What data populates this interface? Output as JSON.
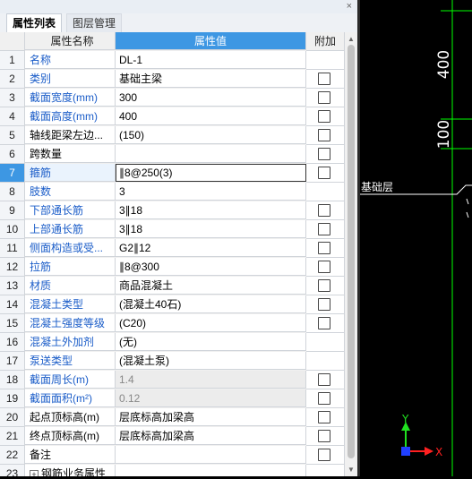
{
  "panel": {
    "close_glyph": "×",
    "tabs": [
      {
        "label": "属性列表"
      },
      {
        "label": "图层管理"
      }
    ],
    "headers": {
      "name": "属性名称",
      "value": "属性值",
      "add": "附加"
    }
  },
  "rows": [
    {
      "num": "1",
      "name": "名称",
      "value": "DL-1",
      "name_style": "blue",
      "checkbox": false
    },
    {
      "num": "2",
      "name": "类别",
      "value": "基础主梁",
      "name_style": "blue",
      "checkbox": true
    },
    {
      "num": "3",
      "name": "截面宽度(mm)",
      "value": "300",
      "name_style": "blue",
      "checkbox": true
    },
    {
      "num": "4",
      "name": "截面高度(mm)",
      "value": "400",
      "name_style": "blue",
      "checkbox": true
    },
    {
      "num": "5",
      "name": "轴线距梁左边...",
      "value": "(150)",
      "name_style": "black",
      "checkbox": true
    },
    {
      "num": "6",
      "name": "跨数量",
      "value": "",
      "name_style": "black",
      "checkbox": true
    },
    {
      "num": "7",
      "name": "箍筋",
      "value": "∥8@250(3)",
      "name_style": "blue",
      "checkbox": true,
      "selected": true
    },
    {
      "num": "8",
      "name": "肢数",
      "value": "3",
      "name_style": "blue",
      "checkbox": false
    },
    {
      "num": "9",
      "name": "下部通长筋",
      "value": "3∥18",
      "name_style": "blue",
      "checkbox": true
    },
    {
      "num": "10",
      "name": "上部通长筋",
      "value": "3∥18",
      "name_style": "blue",
      "checkbox": true
    },
    {
      "num": "11",
      "name": "侧面构造或受...",
      "value": "G2∥12",
      "name_style": "blue",
      "checkbox": true
    },
    {
      "num": "12",
      "name": "拉筋",
      "value": "∥8@300",
      "name_style": "blue",
      "checkbox": true
    },
    {
      "num": "13",
      "name": "材质",
      "value": "商品混凝土",
      "name_style": "blue",
      "checkbox": true
    },
    {
      "num": "14",
      "name": "混凝土类型",
      "value": "(混凝土40石)",
      "name_style": "blue",
      "checkbox": true
    },
    {
      "num": "15",
      "name": "混凝土强度等级",
      "value": "(C20)",
      "name_style": "blue",
      "checkbox": true
    },
    {
      "num": "16",
      "name": "混凝土外加剂",
      "value": "(无)",
      "name_style": "blue",
      "checkbox": false
    },
    {
      "num": "17",
      "name": "泵送类型",
      "value": "(混凝土泵)",
      "name_style": "blue",
      "checkbox": false
    },
    {
      "num": "18",
      "name": "截面周长(m)",
      "value": "1.4",
      "name_style": "blue",
      "checkbox": true,
      "disabled": true
    },
    {
      "num": "19",
      "name": "截面面积(m²)",
      "value": "0.12",
      "name_style": "blue",
      "checkbox": true,
      "disabled": true
    },
    {
      "num": "20",
      "name": "起点顶标高(m)",
      "value": "层底标高加梁高",
      "name_style": "black",
      "checkbox": true
    },
    {
      "num": "21",
      "name": "终点顶标高(m)",
      "value": "层底标高加梁高",
      "name_style": "black",
      "checkbox": true
    },
    {
      "num": "22",
      "name": "备注",
      "value": "",
      "name_style": "black",
      "checkbox": true
    },
    {
      "num": "23",
      "name": "钢筋业务属性",
      "value": "",
      "name_style": "black",
      "checkbox": false,
      "expandable": true
    }
  ],
  "canvas": {
    "dim_top": "400",
    "dim_bottom": "100",
    "layer_label": "基础层",
    "ucs_y": "Y",
    "ucs_x": "X"
  },
  "colors": {
    "header_blue": "#3d97e3",
    "name_blue": "#1a5cc8",
    "dim_green": "#00ff00",
    "ucs_red": "#ff2020",
    "ucs_green": "#20e020"
  }
}
